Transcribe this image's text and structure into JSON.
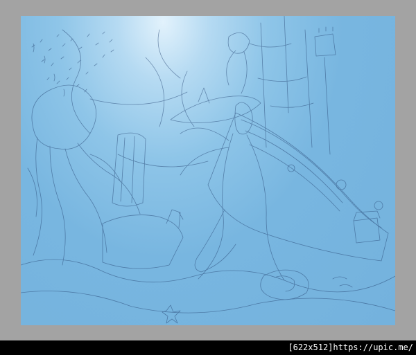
{
  "image": {
    "subject": "pencil-sketch",
    "colors": {
      "frame": "#a3a3a3",
      "canvas": "#74b2dd",
      "light": "#e2f2fc",
      "stroke": "#2a4a78",
      "footer": "#000000",
      "footer_text": "#ffffff"
    }
  },
  "footer": {
    "watermark": "[622x512]https://upic.me/"
  }
}
